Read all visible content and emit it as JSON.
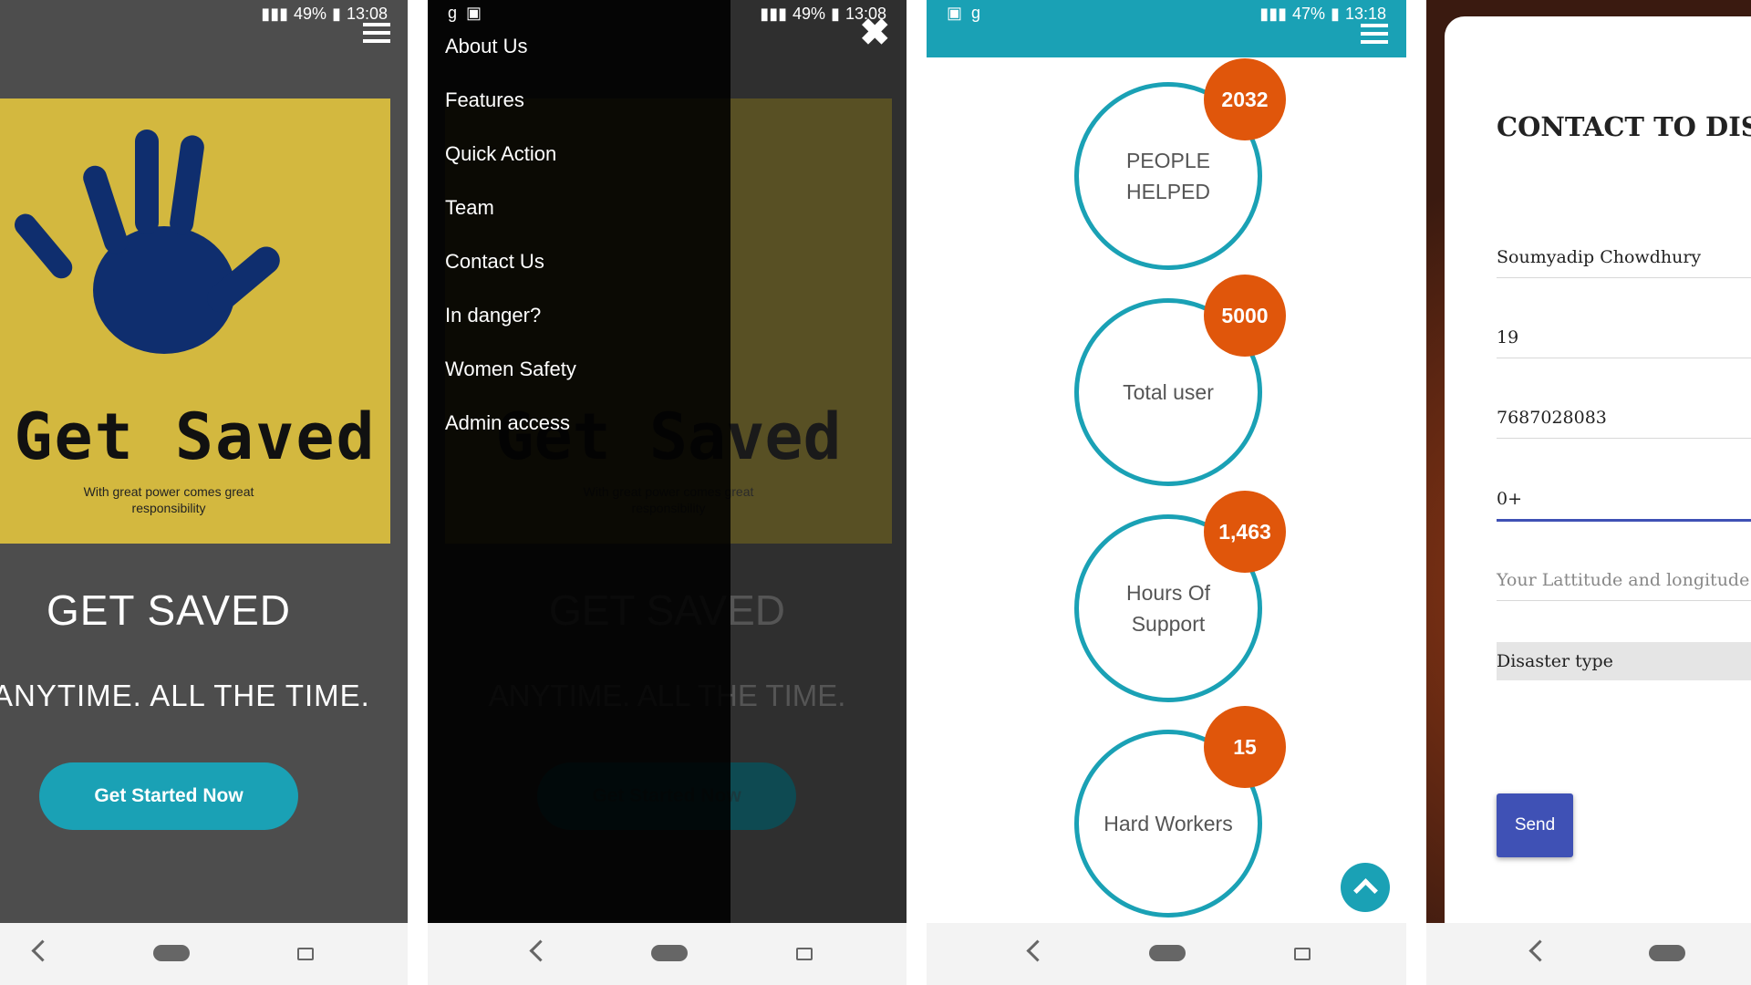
{
  "colors": {
    "teal": "#1aa1b5",
    "orange": "#e0560b",
    "logo_yellow": "#d3b83f",
    "indigo": "#3f51b5"
  },
  "screen1": {
    "status": {
      "battery": "49%",
      "time": "13:08"
    },
    "logo": {
      "title": "Get Saved",
      "tagline": "With great power comes great responsibility",
      "icon": "hand-print-icon"
    },
    "hero_title": "GET SAVED",
    "hero_subtitle": "ANYTIME. ALL THE TIME.",
    "cta_label": "Get Started Now"
  },
  "screen2": {
    "status": {
      "battery": "49%",
      "time": "13:08"
    },
    "close_glyph": "✖",
    "menu": [
      {
        "label": "About Us"
      },
      {
        "label": "Features"
      },
      {
        "label": "Quick Action"
      },
      {
        "label": "Team"
      },
      {
        "label": "Contact Us"
      },
      {
        "label": "In danger?"
      },
      {
        "label": "Women Safety"
      },
      {
        "label": "Admin access"
      }
    ],
    "bg_hero_title": "GET SAVED",
    "bg_hero_subtitle": "ANYTIME. ALL THE TIME.",
    "bg_cta": "Get Started Now",
    "bg_logo_title": "Get Saved",
    "bg_logo_tagline": "With great power comes great responsibility"
  },
  "screen3": {
    "status": {
      "battery": "47%",
      "time": "13:18"
    },
    "counters": [
      {
        "value": "2032",
        "label": "PEOPLE HELPED"
      },
      {
        "value": "5000",
        "label": "Total user"
      },
      {
        "value": "1,463",
        "label": "Hours Of Support"
      },
      {
        "value": "15",
        "label": "Hard Workers"
      }
    ]
  },
  "screen4": {
    "form_title": "CONTACT TO DISASTER TEAM",
    "fields": {
      "name": "Soumyadip Chowdhury",
      "age": "19",
      "phone": "7687028083",
      "blood_group": "0+",
      "location_placeholder": "Your Lattitude and longitude",
      "disaster_type": "Disaster type"
    },
    "send_label": "Send"
  }
}
